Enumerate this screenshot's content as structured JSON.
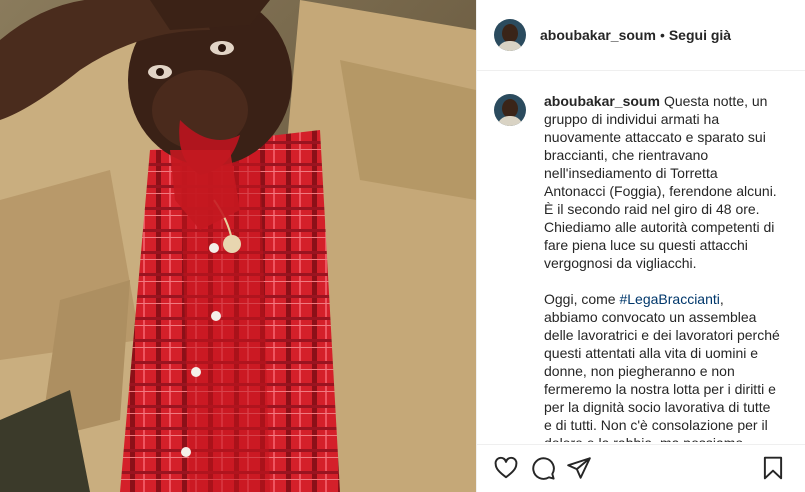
{
  "post": {
    "username": "aboubakar_soum",
    "dot": "•",
    "follow_label": "Segui già"
  },
  "caption": {
    "username": "aboubakar_soum",
    "paragraph1": "Questa notte, un gruppo di individui armati ha nuovamente attaccato e sparato sui braccianti, che rientravano nell'insediamento di Torretta Antonacci (Foggia), ferendone alcuni. È il secondo raid nel giro di 48 ore. Chiediamo alle autorità competenti di fare piena luce su questi attacchi vergognosi da vigliacchi.",
    "paragraph2_before": "Oggi, come ",
    "hashtag": "#LegaBraccianti",
    "paragraph2_after": ", abbiamo convocato un assemblea delle lavoratrici e dei lavoratori perché questi attentati alla vita di uomini e donne, non piegheranno e non fermeremo la nostra lotta per i diritti e per la dignità socio lavorativa di tutte e di tutti. Non c'è consolazione per il dolore e la rabbia, ma possiamo trasformarli in"
  },
  "icons": {
    "like": "heart-icon",
    "comment": "comment-icon",
    "share": "paper-plane-icon",
    "save": "bookmark-icon"
  },
  "colors": {
    "text": "#262626",
    "hashtag": "#00376b",
    "divider": "#efefef"
  }
}
